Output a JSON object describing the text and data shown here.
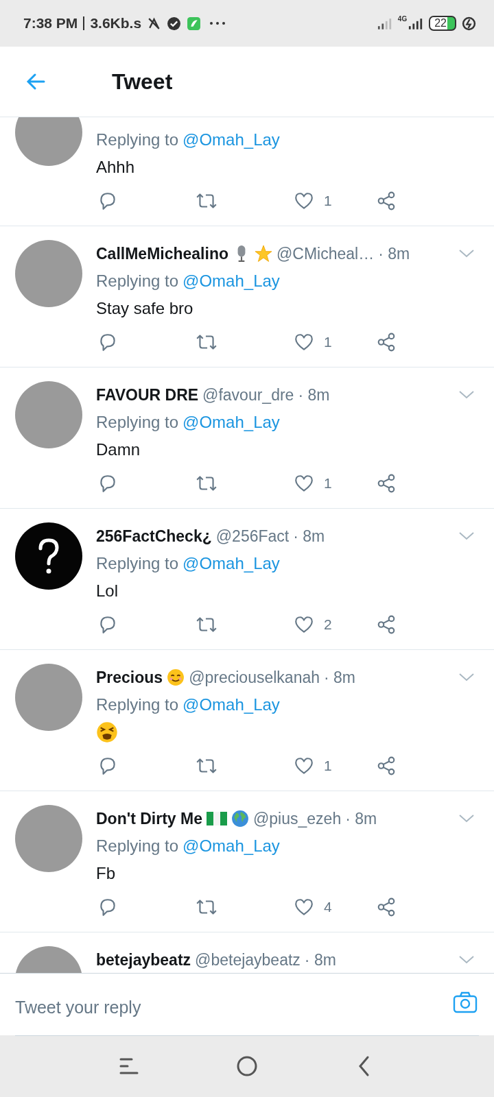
{
  "status_bar": {
    "time": "7:38 PM",
    "speed": "3.6Kb.s",
    "network": "4G",
    "battery": "22"
  },
  "header": {
    "title": "Tweet"
  },
  "tweets": [
    {
      "avatar": {
        "kind": "photo"
      },
      "replying_label": "Replying to",
      "replying_to": "@Omah_Lay",
      "text": "Ahhh",
      "like_count": "1"
    },
    {
      "avatar": {
        "kind": "photo"
      },
      "name": "CallMeMichealino",
      "name_icons": [
        {
          "kind": "microphone"
        },
        {
          "kind": "star"
        }
      ],
      "handle": "@CMicheal…",
      "time": "· 8m",
      "replying_label": "Replying to",
      "replying_to": "@Omah_Lay",
      "text": "Stay safe bro",
      "like_count": "1"
    },
    {
      "avatar": {
        "kind": "photo"
      },
      "name": "FAVOUR DRE",
      "handle": "@favour_dre",
      "time": "· 8m",
      "replying_label": "Replying to",
      "replying_to": "@Omah_Lay",
      "text": "Damn",
      "like_count": "1"
    },
    {
      "avatar": {
        "kind": "question"
      },
      "name": "256FactCheck¿",
      "handle": "@256Fact",
      "time": "· 8m",
      "replying_label": "Replying to",
      "replying_to": "@Omah_Lay",
      "text": "Lol",
      "like_count": "2"
    },
    {
      "avatar": {
        "kind": "photo"
      },
      "name": "Precious",
      "name_icons": [
        {
          "kind": "smiley"
        }
      ],
      "handle": "@preciouselkanah",
      "time": "· 8m",
      "replying_label": "Replying to",
      "replying_to": "@Omah_Lay",
      "body_icon": {
        "kind": "tired-face"
      },
      "like_count": "1"
    },
    {
      "avatar": {
        "kind": "photo"
      },
      "name": "Don't Dirty Me",
      "name_icons": [
        {
          "kind": "flag"
        },
        {
          "kind": "globe"
        }
      ],
      "handle": "@pius_ezeh",
      "time": "· 8m",
      "replying_label": "Replying to",
      "replying_to": "@Omah_Lay",
      "text": "Fb",
      "like_count": "4"
    },
    {
      "avatar": {
        "kind": "photo"
      },
      "name": "betejaybeatz",
      "handle": "@betejaybeatz",
      "time": "· 8m"
    }
  ],
  "reply_box": {
    "placeholder": "Tweet your reply"
  }
}
